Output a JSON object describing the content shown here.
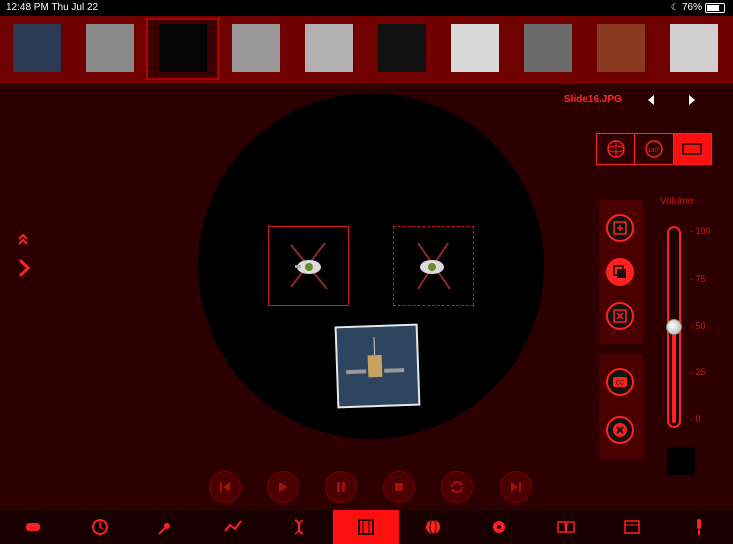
{
  "status_bar": {
    "time": "12:48 PM  Thu Jul 22",
    "battery": "76%"
  },
  "thumbnails": [
    {
      "name": "spacecraft-thumb-1",
      "tone": "#2a3a55"
    },
    {
      "name": "crater-surface-thumb",
      "tone": "#8a8a8a"
    },
    {
      "name": "spacecraft-thumb-2",
      "tone": "#050505"
    },
    {
      "name": "terrain-map-thumb",
      "tone": "#9a9a9a"
    },
    {
      "name": "surface-features-thumb",
      "tone": "#b0b0b0"
    },
    {
      "name": "moons-thumb",
      "tone": "#111111"
    },
    {
      "name": "cracked-ice-thumb",
      "tone": "#d8d8d8"
    },
    {
      "name": "doorway-photo-thumb",
      "tone": "#6a6a6a"
    },
    {
      "name": "poster-thumb",
      "tone": "#8a3a20"
    },
    {
      "name": "rocket-photo-thumb",
      "tone": "#cfcfcf"
    }
  ],
  "active_thumb_index": 2,
  "viewer": {
    "filename": "Slide16.JPG"
  },
  "volume": {
    "label": "Volume",
    "ticks": [
      "- 100",
      "- 75",
      "- 50",
      "- 25",
      "- 0"
    ],
    "level": 0.5
  },
  "tabs": [
    {
      "name": "tab-games",
      "icon": "gamepad-icon"
    },
    {
      "name": "tab-clock",
      "icon": "clock-icon"
    },
    {
      "name": "tab-meteor",
      "icon": "meteor-icon"
    },
    {
      "name": "tab-graph",
      "icon": "graph-icon"
    },
    {
      "name": "tab-dna",
      "icon": "dna-icon"
    },
    {
      "name": "tab-media",
      "icon": "film-icon"
    },
    {
      "name": "tab-globe",
      "icon": "globe-icon"
    },
    {
      "name": "tab-settings",
      "icon": "gear-icon"
    },
    {
      "name": "tab-book",
      "icon": "book-icon"
    },
    {
      "name": "tab-calendar",
      "icon": "calendar-icon"
    },
    {
      "name": "tab-mic",
      "icon": "microphone-icon"
    }
  ],
  "active_tab_index": 5,
  "colors": {
    "accent": "#ff2020",
    "bg": "#2c0000",
    "strip": "#6e0000"
  }
}
